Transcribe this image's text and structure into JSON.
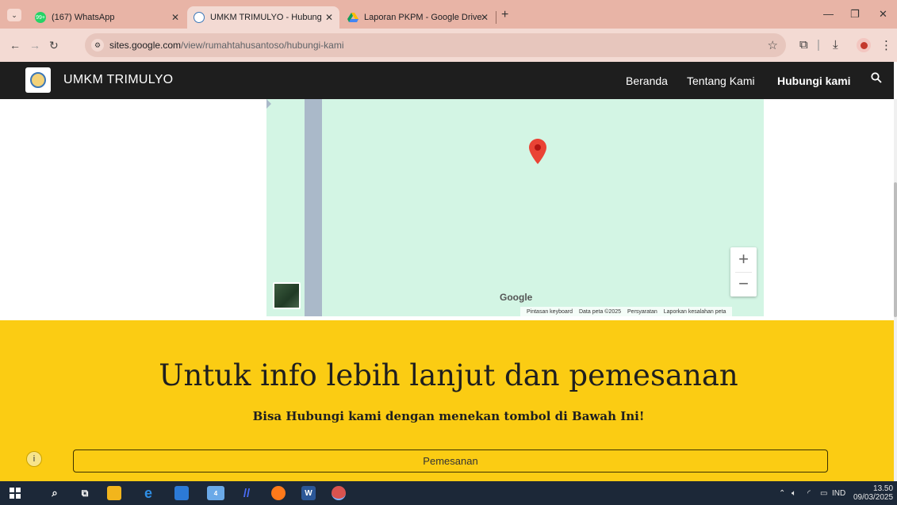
{
  "browser": {
    "tabs": [
      {
        "title": "(167) WhatsApp",
        "favicon": "whatsapp-icon",
        "badge": "99+"
      },
      {
        "title": "UMKM TRIMULYO - Hubungi ka",
        "favicon": "site-logo-icon"
      },
      {
        "title": "Laporan PKPM - Google Drive",
        "favicon": "google-drive-icon"
      }
    ],
    "url_domain": "sites.google.com",
    "url_path": "/view/rumahtahusantoso/hubungi-kami"
  },
  "site": {
    "title": "UMKM TRIMULYO",
    "nav": [
      {
        "label": "Beranda",
        "active": false
      },
      {
        "label": "Tentang Kami",
        "active": false
      },
      {
        "label": "Hubungi kami",
        "active": true
      }
    ]
  },
  "map": {
    "google_logo": "Google",
    "zoom_in": "+",
    "zoom_out": "−",
    "footer": [
      "Pintasan keyboard",
      "Data peta ©2025",
      "Persyaratan",
      "Laporkan kesalahan peta"
    ]
  },
  "promo": {
    "title": "Untuk info lebih lanjut dan pemesanan",
    "subtitle": "Bisa Hubungi kami dengan menekan tombol di Bawah Ini!",
    "button_label": "Pemesanan"
  },
  "taskbar": {
    "language": "IND",
    "time": "13.50",
    "date": "09/03/2025",
    "mail_badge": "4"
  },
  "colors": {
    "header_bg": "#1e1e1e",
    "promo_bg": "#fbcc13",
    "map_bg": "#d3f5e4",
    "tab_strip": "#e8b4a6"
  }
}
